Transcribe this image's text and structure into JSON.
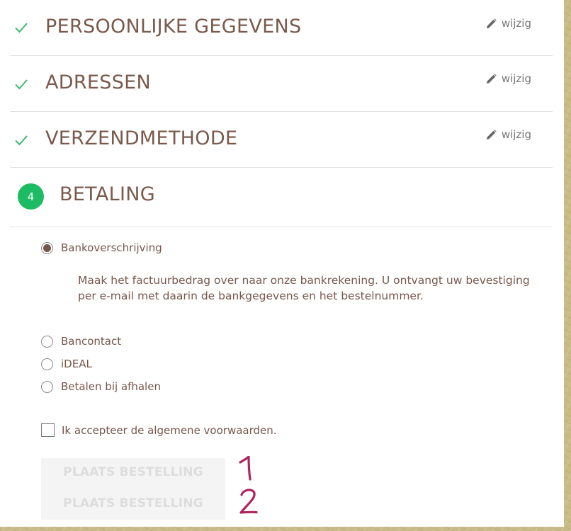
{
  "steps": [
    {
      "title": "PERSOONLIJKE GEGEVENS",
      "completed": true,
      "edit_label": "wijzig"
    },
    {
      "title": "ADRESSEN",
      "completed": true,
      "edit_label": "wijzig"
    },
    {
      "title": "VERZENDMETHODE",
      "completed": true,
      "edit_label": "wijzig"
    }
  ],
  "payment_step": {
    "number": "4",
    "title": "BETALING"
  },
  "payment_options": [
    {
      "label": "Bankoverschrijving",
      "selected": true
    },
    {
      "label": "Bancontact",
      "selected": false
    },
    {
      "label": "iDEAL",
      "selected": false
    },
    {
      "label": "Betalen bij afhalen",
      "selected": false
    }
  ],
  "payment_description": "Maak het factuurbedrag over naar onze bankrekening. U ontvangt uw bevestiging per e-mail met daarin de bankgegevens en het bestelnummer.",
  "terms": {
    "label": "Ik accepteer de algemene voorwaarden.",
    "checked": false
  },
  "order_buttons": [
    {
      "label": "PLAATS BESTELLING",
      "disabled": true
    },
    {
      "label": "PLAATS BESTELLING",
      "disabled": true
    }
  ],
  "annotations": [
    "1",
    "2"
  ],
  "colors": {
    "text": "#77574a",
    "check": "#3dbb70",
    "step_badge": "#1dbb63",
    "background": "#c9bb88",
    "disabled_button_bg": "#f4f4f4"
  },
  "icons": {
    "completed": "check-icon",
    "edit": "pencil-icon"
  }
}
